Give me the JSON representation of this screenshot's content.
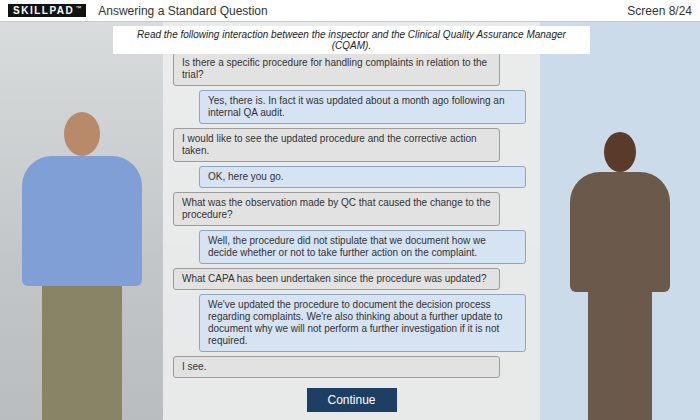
{
  "header": {
    "logo": "SKILLPAD",
    "trademark": "™",
    "title": "Answering a Standard Question",
    "screen": "Screen 8/24"
  },
  "instruction": "Read the following interaction between the inspector and the Clinical Quality Assurance Manager (CQAM).",
  "messages": [
    {
      "kind": "inspector",
      "text": "Is there a specific procedure for handling complaints in relation to the trial?"
    },
    {
      "kind": "cqam",
      "text": "Yes, there is. In fact it was updated about a month ago following an internal QA audit."
    },
    {
      "kind": "inspector",
      "text": "I would like to see the updated procedure and the corrective action taken."
    },
    {
      "kind": "cqam",
      "text": "OK, here you go."
    },
    {
      "kind": "inspector",
      "text": "What was the observation made by QC that caused the change to the procedure?"
    },
    {
      "kind": "cqam",
      "text": "Well, the procedure did not stipulate that we document how we decide whether or not to take further action on the complaint."
    },
    {
      "kind": "inspector",
      "text": "What CAPA has been undertaken since the procedure was updated?"
    },
    {
      "kind": "cqam",
      "text": "We've updated the procedure to document the decision process regarding complaints. We're also thinking about a further update to document why we will not perform a further investigation if it is not required."
    },
    {
      "kind": "inspector",
      "text": "I see."
    }
  ],
  "button": "Continue"
}
